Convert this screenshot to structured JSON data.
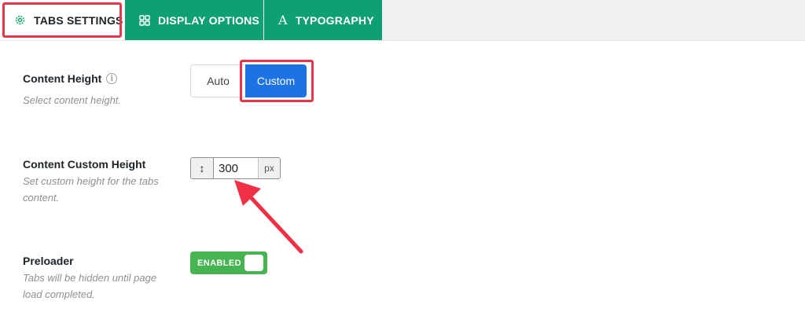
{
  "tabs": [
    {
      "label": "TABS SETTINGS",
      "icon": "gear-icon",
      "active": true
    },
    {
      "label": "DISPLAY OPTIONS",
      "icon": "grid-icon",
      "active": false
    },
    {
      "label": "TYPOGRAPHY",
      "icon": "font-icon",
      "active": false
    }
  ],
  "typography_glyph": "A",
  "content_height": {
    "label": "Content Height",
    "info": "i",
    "description": "Select content height.",
    "options": [
      "Auto",
      "Custom"
    ],
    "selected": "Custom"
  },
  "content_custom_height": {
    "label": "Content Custom Height",
    "description_lines": [
      "Set custom height for the tabs",
      "content."
    ],
    "prefix_icon": "↕",
    "value": "300",
    "unit": "px"
  },
  "preloader": {
    "label": "Preloader",
    "description_lines": [
      "Tabs will be hidden until page",
      "load completed."
    ],
    "toggle_label": "ENABLED",
    "enabled": true
  },
  "colors": {
    "accent_green": "#0e9f72",
    "button_blue": "#1e73e4",
    "toggle_green": "#46b450",
    "highlight_red": "#e8374a"
  }
}
